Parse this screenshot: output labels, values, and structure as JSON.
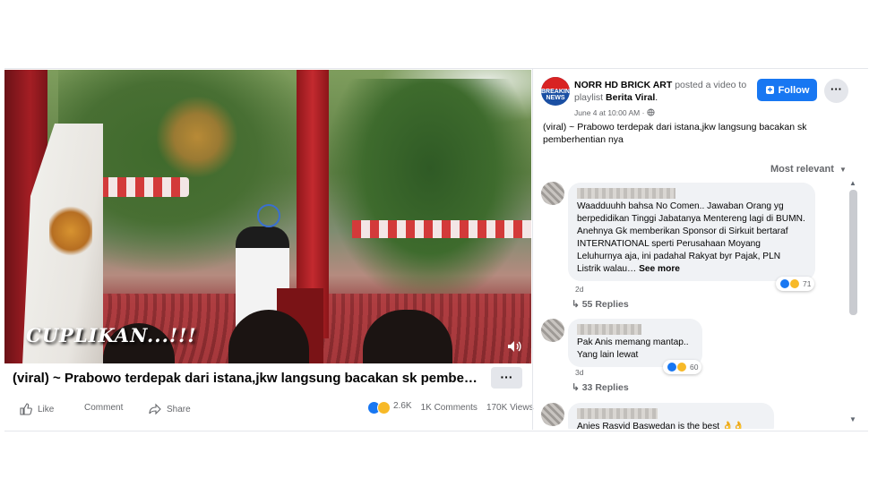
{
  "video": {
    "overlay_caption": "CUPLIKAN...!!!"
  },
  "post": {
    "title": "(viral) ~ Prabowo terdepak dari istana,jkw langsung bacakan sk pembe…",
    "more_label": "···",
    "actions": {
      "like": "Like",
      "comment": "Comment",
      "share": "Share"
    },
    "stats": {
      "reactions": "2.6K",
      "comments": "1K Comments",
      "views": "170K Views"
    }
  },
  "sidebar": {
    "page_name": "NORR HD BRICK ART",
    "posted_text": "posted a video to playlist",
    "playlist": "Berita Viral",
    "avatar_text": "BREAKING NEWS",
    "time": "June 4 at 10:00 AM ·",
    "follow_label": "Follow",
    "more_label": "···",
    "description": "(viral) ~ Prabowo terdepak dari istana,jkw langsung bacakan sk pemberhentian nya",
    "sort_label": "Most relevant"
  },
  "comments": [
    {
      "text": "Waadduuhh bahsa No Comen.. Jawaban Orang yg berpedidikan Tinggi Jabatanya Mentereng lagi di BUMN. Anehnya Gk memberikan Sponsor di Sirkuit bertaraf INTERNATIONAL sperti Perusahaan Moyang Leluhurnya aja, ini padahal Rakyat byr Pajak, PLN Listrik walau…",
      "see_more": "See more",
      "reactions": "71",
      "time": "2d",
      "replies": "55 Replies"
    },
    {
      "text_line1": "Pak Anis memang mantap..",
      "text_line2": "Yang lain lewat",
      "reactions": "60",
      "time": "3d",
      "replies": "33 Replies"
    },
    {
      "text": "Anies Rasyid Baswedan is the best"
    }
  ]
}
